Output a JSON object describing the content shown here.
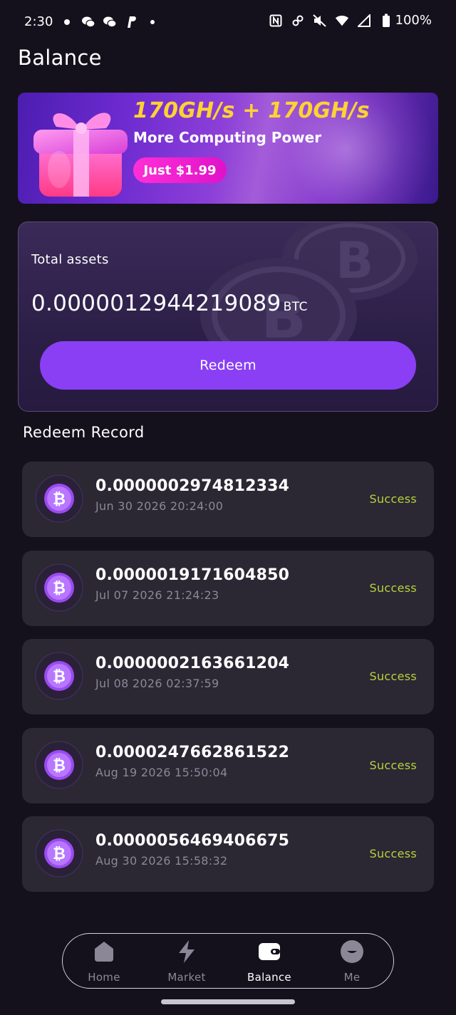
{
  "status_bar": {
    "time": "2:30",
    "battery": "100%",
    "left_icons": [
      "dot-icon",
      "wechat-icon",
      "wechat-icon",
      "paypal-icon",
      "small-dot-icon"
    ],
    "right_icons": [
      "nfc-icon",
      "link-icon",
      "mute-icon",
      "wifi-icon",
      "signal-icon",
      "battery-icon"
    ]
  },
  "page": {
    "title": "Balance"
  },
  "promo": {
    "headline": "170GH/s + 170GH/s",
    "subtitle": "More Computing Power",
    "price_button": "Just $1.99",
    "icon": "gift-icon"
  },
  "assets": {
    "label": "Total assets",
    "amount": "0.0000012944219089",
    "unit": "BTC",
    "redeem_button": "Redeem"
  },
  "records": {
    "title": "Redeem Record",
    "items": [
      {
        "amount": "0.0000002974812334",
        "date": "Jun 30 2026 20:24:00",
        "status": "Success"
      },
      {
        "amount": "0.0000019171604850",
        "date": "Jul 07 2026 21:24:23",
        "status": "Success"
      },
      {
        "amount": "0.0000002163661204",
        "date": "Jul 08 2026 02:37:59",
        "status": "Success"
      },
      {
        "amount": "0.0000247662861522",
        "date": "Aug 19 2026 15:50:04",
        "status": "Success"
      },
      {
        "amount": "0.0000056469406675",
        "date": "Aug 30 2026 15:58:32",
        "status": "Success"
      }
    ]
  },
  "nav": {
    "items": [
      {
        "label": "Home",
        "icon": "home-icon",
        "active": false
      },
      {
        "label": "Market",
        "icon": "lightning-icon",
        "active": false
      },
      {
        "label": "Balance",
        "icon": "wallet-icon",
        "active": true
      },
      {
        "label": "Me",
        "icon": "profile-icon",
        "active": false
      }
    ]
  },
  "colors": {
    "background": "#15111c",
    "accent": "#8a3ff5",
    "status_success": "#b6d33c",
    "promo_headline": "#ffd233",
    "price_pill": "#ff2fd6",
    "card": "#2b2733"
  }
}
